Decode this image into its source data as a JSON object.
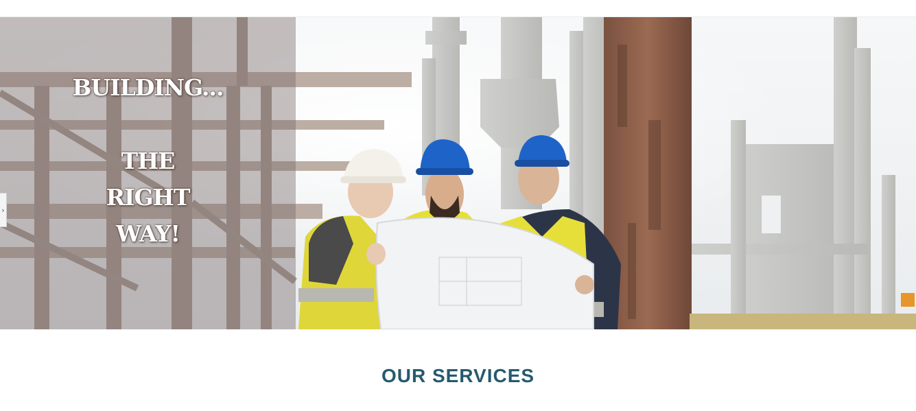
{
  "hero": {
    "line1": "BUILDING...",
    "line2": "THE",
    "line3": "RIGHT",
    "line4": "WAY!",
    "slider_prev_glyph": "›",
    "image_subject": "construction-workers-reviewing-blueprint"
  },
  "sections": {
    "services_title": "OUR SERVICES"
  },
  "colors": {
    "overlay": "#786868",
    "heading": "#265a6d",
    "hardhat_blue": "#1e63c8",
    "vest_yellow": "#e6df3a"
  }
}
